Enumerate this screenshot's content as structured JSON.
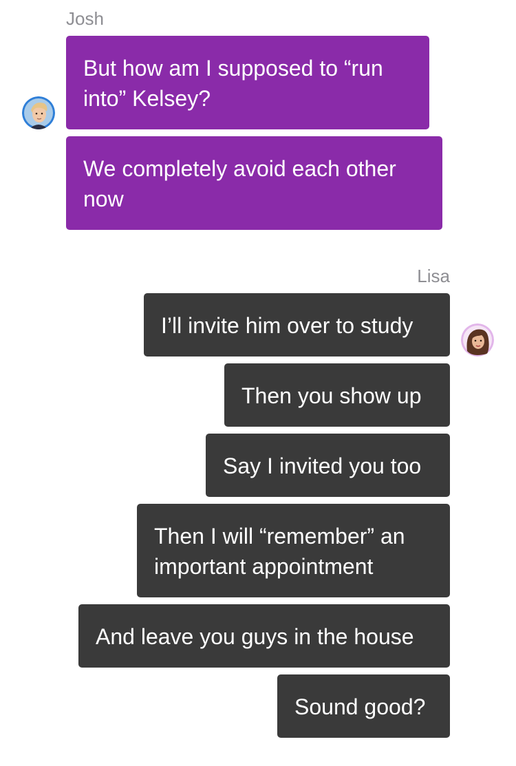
{
  "colors": {
    "josh_bubble": "#8a2ba9",
    "lisa_bubble": "#3a3a3a",
    "name_text": "#8e8e93",
    "bubble_text": "#ffffff"
  },
  "josh": {
    "name": "Josh",
    "avatar_icon": "josh-avatar-icon",
    "messages": [
      "But how am I supposed to “run into” Kelsey?",
      "We completely avoid each other now"
    ]
  },
  "lisa": {
    "name": "Lisa",
    "avatar_icon": "lisa-avatar-icon",
    "messages": [
      "I’ll invite him over to study",
      "Then you show up",
      "Say I invited you too",
      "Then I will “remember” an important appointment",
      "And leave you guys in the house",
      "Sound good?"
    ]
  }
}
